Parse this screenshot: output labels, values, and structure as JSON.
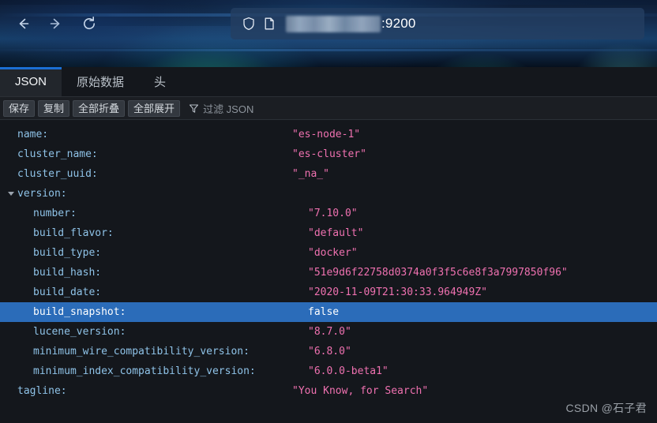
{
  "browser": {
    "nav": {
      "back_label": "Back",
      "forward_label": "Forward",
      "reload_label": "Reload"
    },
    "url_bar": {
      "shield_icon": "shield-icon",
      "page_icon": "page-icon",
      "redacted_url": "",
      "visible_port": ":9200"
    }
  },
  "viewer": {
    "tabs": [
      {
        "label": "JSON",
        "active": true
      },
      {
        "label": "原始数据",
        "active": false
      },
      {
        "label": "头",
        "active": false
      }
    ],
    "toolbar": {
      "save_label": "保存",
      "copy_label": "复制",
      "collapse_all_label": "全部折叠",
      "expand_all_label": "全部展开",
      "filter_icon": "filter-icon",
      "filter_placeholder": "过滤 JSON"
    },
    "rows": [
      {
        "key": "name:",
        "value": "\"es-node-1\"",
        "type": "string",
        "indent": 1,
        "twisty": "",
        "selected": false
      },
      {
        "key": "cluster_name:",
        "value": "\"es-cluster\"",
        "type": "string",
        "indent": 1,
        "twisty": "",
        "selected": false
      },
      {
        "key": "cluster_uuid:",
        "value": "\"_na_\"",
        "type": "string",
        "indent": 1,
        "twisty": "",
        "selected": false
      },
      {
        "key": "version:",
        "value": "",
        "type": "object",
        "indent": 1,
        "twisty": "open",
        "selected": false
      },
      {
        "key": "number:",
        "value": "\"7.10.0\"",
        "type": "string",
        "indent": 2,
        "twisty": "",
        "selected": false
      },
      {
        "key": "build_flavor:",
        "value": "\"default\"",
        "type": "string",
        "indent": 2,
        "twisty": "",
        "selected": false
      },
      {
        "key": "build_type:",
        "value": "\"docker\"",
        "type": "string",
        "indent": 2,
        "twisty": "",
        "selected": false
      },
      {
        "key": "build_hash:",
        "value": "\"51e9d6f22758d0374a0f3f5c6e8f3a7997850f96\"",
        "type": "string",
        "indent": 2,
        "twisty": "",
        "selected": false
      },
      {
        "key": "build_date:",
        "value": "\"2020-11-09T21:30:33.964949Z\"",
        "type": "string",
        "indent": 2,
        "twisty": "",
        "selected": false
      },
      {
        "key": "build_snapshot:",
        "value": "false",
        "type": "boolean",
        "indent": 2,
        "twisty": "",
        "selected": true
      },
      {
        "key": "lucene_version:",
        "value": "\"8.7.0\"",
        "type": "string",
        "indent": 2,
        "twisty": "",
        "selected": false
      },
      {
        "key": "minimum_wire_compatibility_version:",
        "value": "\"6.8.0\"",
        "type": "string",
        "indent": 2,
        "twisty": "",
        "selected": false
      },
      {
        "key": "minimum_index_compatibility_version:",
        "value": "\"6.0.0-beta1\"",
        "type": "string",
        "indent": 2,
        "twisty": "",
        "selected": false
      },
      {
        "key": "tagline:",
        "value": "\"You Know, for Search\"",
        "type": "string",
        "indent": 1,
        "twisty": "",
        "selected": false
      }
    ]
  },
  "watermark": {
    "text": "CSDN @石子君"
  },
  "colors": {
    "accent_tab": "#1b6fd4",
    "selection": "#2b6cb9",
    "key_text": "#8fc3e8",
    "string_value": "#ef71b0",
    "viewer_bg": "#14171c"
  }
}
